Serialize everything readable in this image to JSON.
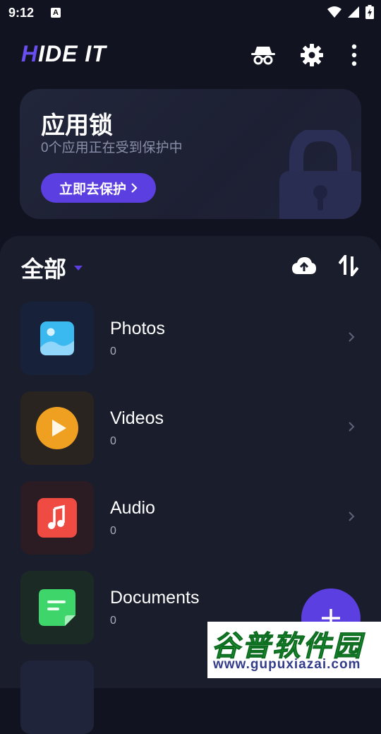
{
  "status_bar": {
    "time": "9:12",
    "notification_icon": "a-icon"
  },
  "header": {
    "logo_part1": "H",
    "logo_part2": "IDE IT",
    "icons": [
      "incognito-icon",
      "gear-icon",
      "more-vertical-icon"
    ]
  },
  "lock_card": {
    "title": "应用锁",
    "subtitle": "0个应用正在受到保护中",
    "button_label": "立即去保护",
    "button_icon": "chevron-right-icon"
  },
  "filter": {
    "label": "全部",
    "icon": "caret-down-icon"
  },
  "categories": [
    {
      "name": "Photos",
      "count": "0",
      "icon": "image-icon",
      "color": "#3ab8f0"
    },
    {
      "name": "Videos",
      "count": "0",
      "icon": "play-icon",
      "color": "#f0a020"
    },
    {
      "name": "Audio",
      "count": "0",
      "icon": "music-note-icon",
      "color": "#f04b43"
    },
    {
      "name": "Documents",
      "count": "0",
      "icon": "document-icon",
      "color": "#3ed56b"
    }
  ],
  "fab": {
    "icon": "plus-icon"
  },
  "watermark": {
    "chinese_text": "谷普软件园",
    "url": "www.gupuxiazai.com"
  },
  "colors": {
    "accent": "#5b3fe0",
    "background": "#111320",
    "panel": "#1a1d2c"
  }
}
